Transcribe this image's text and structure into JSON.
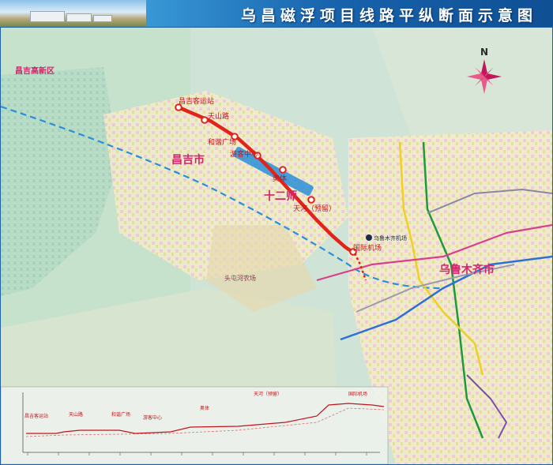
{
  "title": "乌昌磁浮项目线路平纵断面示意图",
  "compass": {
    "letter": "N"
  },
  "regions": {
    "changji_hightech": "昌吉高新区",
    "changji_city": "昌吉市",
    "shierShi": "十二师",
    "urumqi": "乌鲁木齐市",
    "farm": "头屯河农场"
  },
  "stations": {
    "s1": "昌吉客运站",
    "s2": "天山路",
    "s3": "和谐广场",
    "s4": "游客中心",
    "s5": "奥体",
    "s6": "天河（预留）",
    "s7": "国际机场"
  },
  "other_labels": {
    "airport_t": "乌鲁木齐机场"
  },
  "profile": {
    "stations": [
      "昌吉客运站",
      "天山路",
      "和谐广场",
      "游客中心",
      "奥体",
      "天河（预留）",
      "国际机场"
    ],
    "ticks": [
      "0",
      "",
      "",
      "",
      "",
      "",
      "",
      "",
      "",
      "",
      "",
      ""
    ]
  },
  "colors": {
    "maglev": "#e2231a",
    "railway": "#2a8fd8",
    "metro_green": "#1e9a3a",
    "metro_yellow": "#f0d020",
    "metro_blue": "#2c6fd6",
    "metro_pink": "#d93f8c",
    "metro_purple": "#7b4fb0"
  }
}
